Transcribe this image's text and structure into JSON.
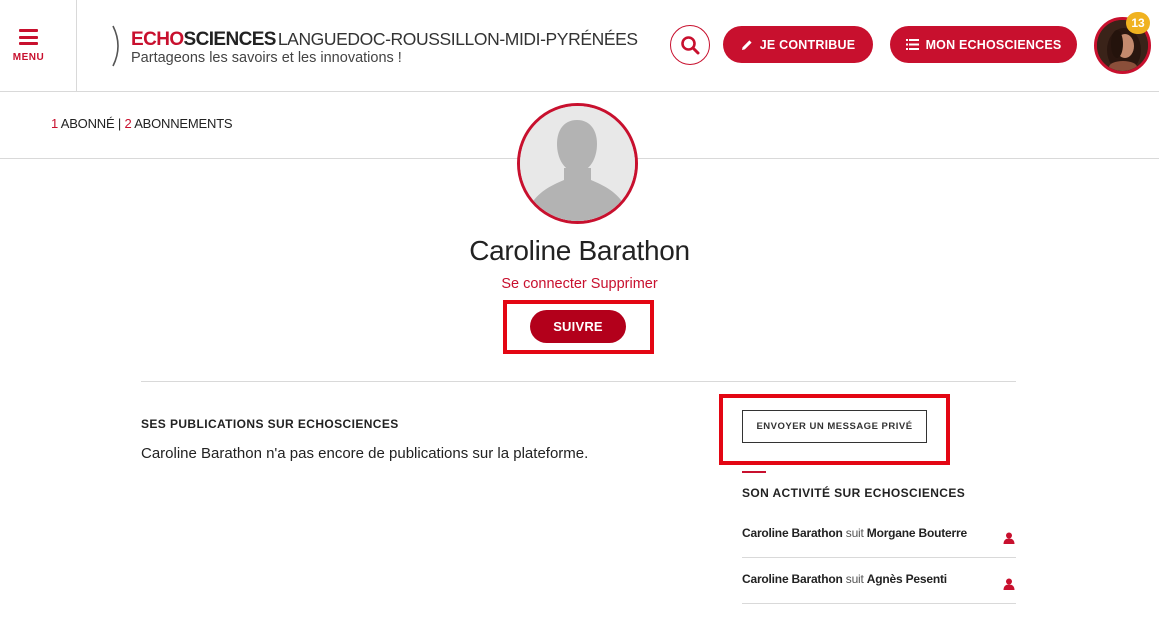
{
  "header": {
    "menu_label": "MENU",
    "brand_echo": "ECHO",
    "brand_sciences": "SCIENCES",
    "brand_region": "LANGUEDOC-ROUSSILLON-MIDI-PYRÉNÉES",
    "tagline": "Partageons les savoirs et les innovations !",
    "contribute_label": "JE CONTRIBUE",
    "my_echosciences_label": "MON ECHOSCIENCES",
    "notification_count": "13",
    "accent_color": "#c8102e",
    "badge_color": "#f0b21f"
  },
  "subscriptions": {
    "followers_count": "1",
    "followers_label": "ABONNÉ",
    "separator": "|",
    "following_count": "2",
    "following_label": "ABONNEMENTS"
  },
  "profile": {
    "name": "Caroline Barathon",
    "connect_label": "Se connecter",
    "delete_label": "Supprimer",
    "follow_label": "SUIVRE"
  },
  "publications": {
    "title": "SES PUBLICATIONS SUR ECHOSCIENCES",
    "empty_text": "Caroline Barathon n'a pas encore de publications sur la plateforme."
  },
  "message": {
    "button_label": "ENVOYER UN MESSAGE PRIVÉ"
  },
  "activity": {
    "title": "SON ACTIVITÉ SUR ECHOSCIENCES",
    "items": [
      {
        "actor": "Caroline Barathon",
        "verb": "suit",
        "target": "Morgane Bouterre"
      },
      {
        "actor": "Caroline Barathon",
        "verb": "suit",
        "target": "Agnès Pesenti"
      }
    ]
  },
  "icons": {
    "menu": "hamburger-icon",
    "search": "search-icon",
    "contribute": "pencil-icon",
    "my_echosciences": "list-icon",
    "activity": "user-icon"
  }
}
